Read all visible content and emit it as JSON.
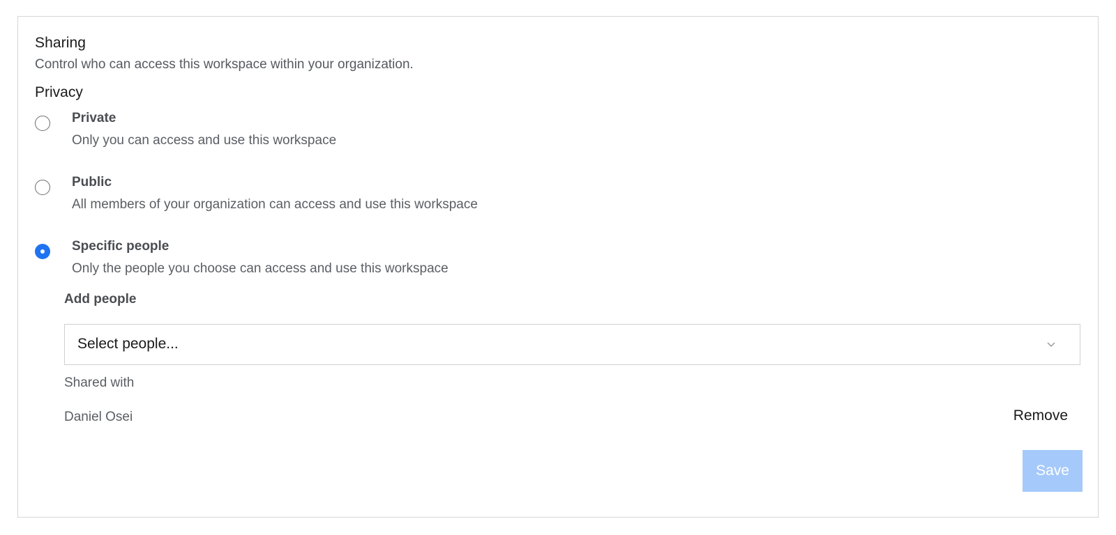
{
  "sharing": {
    "title": "Sharing",
    "description": "Control who can access this workspace within your organization."
  },
  "privacy": {
    "title": "Privacy",
    "selected": "specific",
    "options": [
      {
        "id": "private",
        "label": "Private",
        "description": "Only you can access and use this workspace"
      },
      {
        "id": "public",
        "label": "Public",
        "description": "All members of your organization can access and use this workspace"
      },
      {
        "id": "specific",
        "label": "Specific people",
        "description": "Only the people you choose can access and use this workspace"
      }
    ]
  },
  "add_people": {
    "label": "Add people",
    "select_placeholder": "Select people...",
    "icon": "chevron-down-icon"
  },
  "shared_with": {
    "label": "Shared with",
    "people": [
      {
        "name": "Daniel Osei",
        "action_label": "Remove"
      }
    ]
  },
  "actions": {
    "save_label": "Save",
    "save_disabled": true
  },
  "colors": {
    "accent": "#1f73f1",
    "save_disabled_bg": "#a5c9fb",
    "border": "#d6d6d6"
  }
}
